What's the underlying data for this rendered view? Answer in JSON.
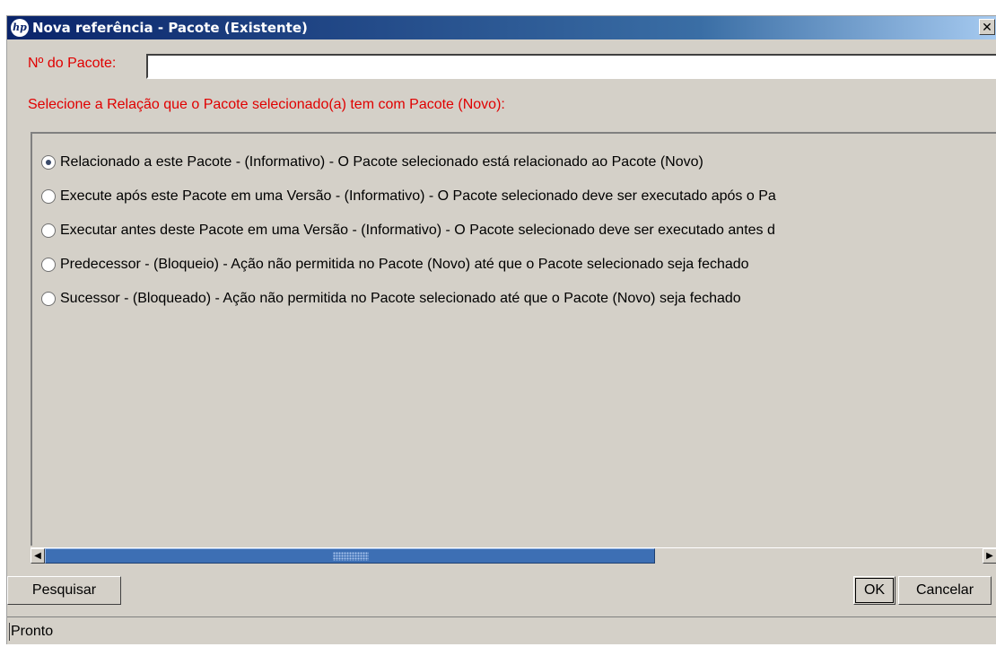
{
  "window": {
    "title": "Nova referência - Pacote (Existente)",
    "logo": "hp",
    "close_glyph": "✕"
  },
  "form": {
    "package_label": "Nº do Pacote:",
    "package_value": "",
    "prompt": "Selecione a Relação que o Pacote selecionado(a) tem com Pacote (Novo):"
  },
  "relations": {
    "selected_index": 0,
    "options": [
      {
        "label": "Relacionado a este Pacote - (Informativo) - O Pacote selecionado está relacionado ao Pacote (Novo)"
      },
      {
        "label": "Execute após este Pacote em uma Versão - (Informativo) - O Pacote selecionado deve ser executado após o Pa"
      },
      {
        "label": "Executar antes deste Pacote em uma Versão - (Informativo) - O Pacote selecionado deve ser executado antes d"
      },
      {
        "label": "Predecessor - (Bloqueio) - Ação não permitida no Pacote (Novo) até que o Pacote selecionado seja fechado"
      },
      {
        "label": "Sucessor - (Bloqueado) - Ação não permitida no Pacote selecionado até que o Pacote (Novo) seja fechado"
      }
    ]
  },
  "scrollbar": {
    "left_arrow": "◀",
    "right_arrow": "▶"
  },
  "buttons": {
    "search": "Pesquisar",
    "ok": "OK",
    "cancel": "Cancelar"
  },
  "status": {
    "text": "Pronto"
  },
  "colors": {
    "label_red": "#e00000",
    "title_blue": "#0a246a",
    "scroll_thumb": "#3d6fb4",
    "window_bg": "#d4d0c8"
  }
}
